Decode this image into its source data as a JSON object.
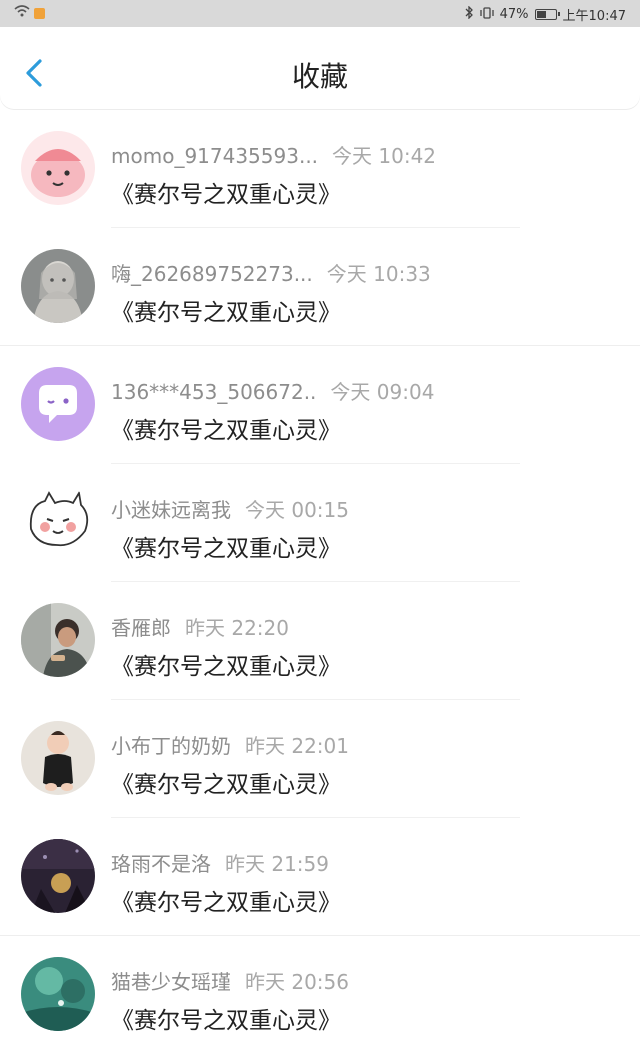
{
  "status_bar": {
    "battery_percent": "47%",
    "time": "上午10:47",
    "battery_level": 0.47
  },
  "header": {
    "title": "收藏",
    "back_icon": "chevron-left-icon",
    "accent_color": "#2d9cdb"
  },
  "items": [
    {
      "user": "momo_917435593...",
      "time": "今天 10:42",
      "title": "《赛尔号之双重心灵》",
      "avatar": "pink-blob-avatar"
    },
    {
      "user": "嗨_262689752273...",
      "time": "今天 10:33",
      "title": "《赛尔号之双重心灵》",
      "avatar": "anime-girl-avatar"
    },
    {
      "user": "136***453_506672..",
      "time": "今天 09:04",
      "title": "《赛尔号之双重心灵》",
      "avatar": "purple-chat-avatar"
    },
    {
      "user": "小迷妹远离我",
      "time": "今天 00:15",
      "title": "《赛尔号之双重心灵》",
      "avatar": "cartoon-cat-avatar"
    },
    {
      "user": "香雁郎",
      "time": "昨天 22:20",
      "title": "《赛尔号之双重心灵》",
      "avatar": "photo-person-avatar"
    },
    {
      "user": "小布丁的奶奶",
      "time": "昨天 22:01",
      "title": "《赛尔号之双重心灵》",
      "avatar": "baby-photo-avatar"
    },
    {
      "user": "珞雨不是洛",
      "time": "昨天 21:59",
      "title": "《赛尔号之双重心灵》",
      "avatar": "dark-scene-avatar"
    },
    {
      "user": "猫巷少女瑶瑾",
      "time": "昨天 20:56",
      "title": "《赛尔号之双重心灵》",
      "avatar": "teal-scene-avatar"
    }
  ]
}
